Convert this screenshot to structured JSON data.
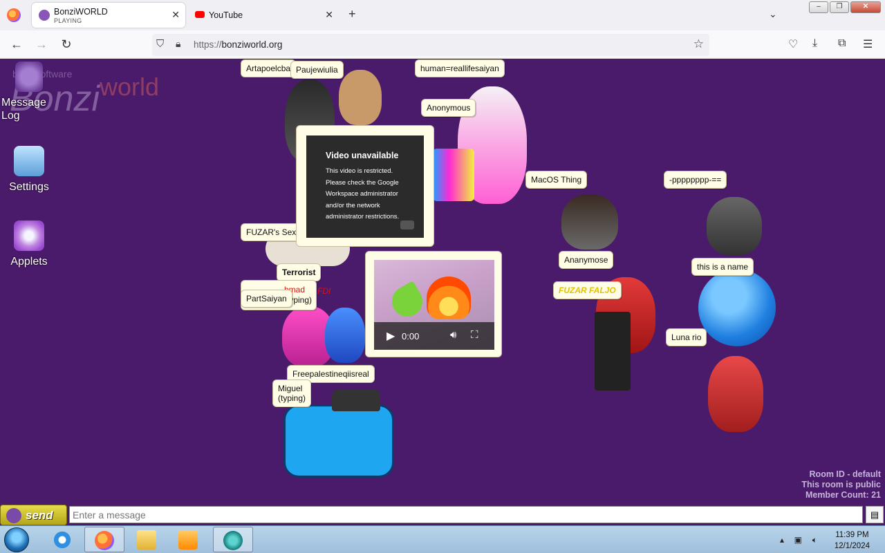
{
  "browser": {
    "tabs": [
      {
        "title": "BonziWORLD",
        "subtitle": "PLAYING",
        "active": true
      },
      {
        "title": "YouTube",
        "active": false
      }
    ],
    "url_scheme": "https://",
    "url_host": "bonziworld.org",
    "new_tab_symbol": "+",
    "close_symbol": "✕"
  },
  "logo": {
    "small": "bonzisoftware",
    "big": "Bonzi",
    "world": "world"
  },
  "desktop_icons": [
    {
      "label": "Message Log"
    },
    {
      "label": "Settings"
    },
    {
      "label": "Applets"
    }
  ],
  "bubbles": {
    "artapo": "Artapoelcba",
    "paujew": "Paujewiulia",
    "human": "human=reallifesaiyan",
    "anonymous": "Anonymous",
    "macos": "MacOS Thing",
    "pppp": "-pppppppp-==",
    "fuzar_sexy": "FUZAR's Sexy",
    "terrorist": "Terrorist",
    "ahmad": "hmad",
    "typing1": "typing)",
    "fdi": "FDI",
    "partsaiyan": "PartSaiyan",
    "anaymose": "Ananymose",
    "fuzar_faljo": "FUZAR FALJO",
    "this_is_name": "this is a name",
    "luna": "Luna rio",
    "freepal": "Freepalestineqiisreal",
    "miguel": "Miguel",
    "miguel_typing": "(typing)"
  },
  "youtube_error": {
    "heading": "Video unavailable",
    "body": "This video is restricted. Please check the Google Workspace administrator and/or the network administrator restrictions."
  },
  "video_player": {
    "time": "0:00"
  },
  "room": {
    "id_line": "Room ID - default",
    "public_line": "This room is public",
    "members_line": "Member Count: 21"
  },
  "chat": {
    "send_label": "send",
    "placeholder": "Enter a message"
  },
  "taskbar": {
    "time": "11:39 PM",
    "date": "12/1/2024"
  }
}
